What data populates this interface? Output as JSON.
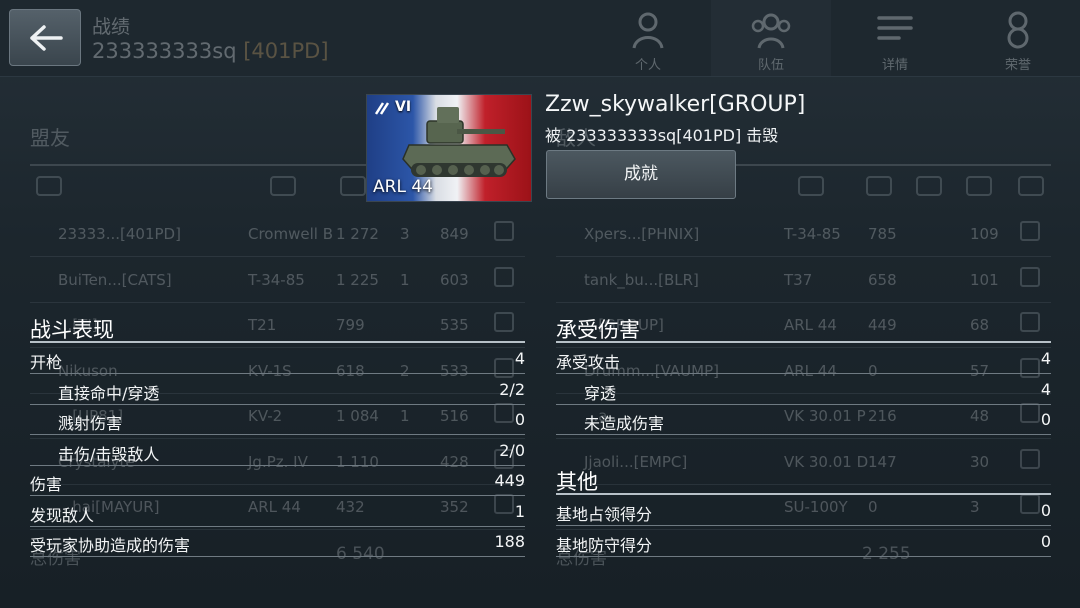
{
  "header": {
    "title": "战绩",
    "player": "233333333sq",
    "clan": "[401PD]",
    "tabs": [
      {
        "label": "个人",
        "icon": "soldier-icon"
      },
      {
        "label": "队伍",
        "icon": "team-icon"
      },
      {
        "label": "详情",
        "icon": "details-list-icon"
      },
      {
        "label": "荣誉",
        "icon": "medal-icon"
      }
    ],
    "active_tab": "队伍"
  },
  "background": {
    "allies_title": "盟友",
    "enemies_title": "敌人",
    "allies_rows": [
      {
        "name": "23333...[401PD]",
        "tank": "Cromwell B",
        "damage": "1 272",
        "kills": "3",
        "exp": "849"
      },
      {
        "name": "BuiTen...[CATS]",
        "tank": "T-34-85",
        "damage": "1 225",
        "kills": "1",
        "exp": "603"
      },
      {
        "name": "...[TI]",
        "tank": "T21",
        "damage": "799",
        "kills": "",
        "exp": "535"
      },
      {
        "name": "Nikuson",
        "tank": "KV-1S",
        "damage": "618",
        "kills": "2",
        "exp": "533"
      },
      {
        "name": "...[UP81]",
        "tank": "KV-2",
        "damage": "1 084",
        "kills": "1",
        "exp": "516"
      },
      {
        "name": "Crystalyte",
        "tank": "Jg.Pz. IV",
        "damage": "1 110",
        "kills": "",
        "exp": "428"
      },
      {
        "name": "...hai[MAYUR]",
        "tank": "ARL 44",
        "damage": "432",
        "kills": "",
        "exp": "352"
      }
    ],
    "enemies_rows": [
      {
        "name": "Xpers...[PHNIX]",
        "tank": "T-34-85",
        "damage": "785",
        "exp": "109"
      },
      {
        "name": "tank_bu...[BLR]",
        "tank": "T37",
        "damage": "658",
        "exp": "101"
      },
      {
        "name": "...[GROUP]",
        "tank": "ARL 44",
        "damage": "449",
        "exp": "68"
      },
      {
        "name": "Drumm...[VAUMP]",
        "tank": "ARL 44",
        "damage": "0",
        "exp": "57"
      },
      {
        "name": "...a...",
        "tank": "VK 30.01 P",
        "damage": "216",
        "exp": "48"
      },
      {
        "name": "Jjaoli...[EMPC]",
        "tank": "VK 30.01 D",
        "damage": "147",
        "exp": "30"
      },
      {
        "name": "",
        "tank": "SU-100Y",
        "damage": "0",
        "exp": "3"
      }
    ],
    "allies_total_label": "总伤害",
    "allies_total": "6 540",
    "enemies_total_label": "总伤害",
    "enemies_total": "2 255"
  },
  "popup": {
    "tank_tier": "VI",
    "tank_name": "ARL 44",
    "player_name": "Zzw_skywalker[GROUP]",
    "killed_by": "被 233333333sq[401PD] 击毁",
    "achievements_button": "成就"
  },
  "combat": {
    "title": "战斗表现",
    "rows": [
      {
        "label": "开枪",
        "value": "4",
        "sub": false
      },
      {
        "label": "直接命中/穿透",
        "value": "2/2",
        "sub": true
      },
      {
        "label": "溅射伤害",
        "value": "0",
        "sub": true
      },
      {
        "label": "击伤/击毁敌人",
        "value": "2/0",
        "sub": true
      },
      {
        "label": "伤害",
        "value": "449",
        "sub": false
      },
      {
        "label": "发现敌人",
        "value": "1",
        "sub": false
      },
      {
        "label": "受玩家协助造成的伤害",
        "value": "188",
        "sub": false
      }
    ]
  },
  "received": {
    "title": "承受伤害",
    "rows": [
      {
        "label": "承受攻击",
        "value": "4",
        "sub": false
      },
      {
        "label": "穿透",
        "value": "4",
        "sub": true
      },
      {
        "label": "未造成伤害",
        "value": "0",
        "sub": true
      }
    ]
  },
  "other": {
    "title": "其他",
    "rows": [
      {
        "label": "基地占领得分",
        "value": "0",
        "sub": false
      },
      {
        "label": "基地防守得分",
        "value": "0",
        "sub": false
      }
    ]
  }
}
